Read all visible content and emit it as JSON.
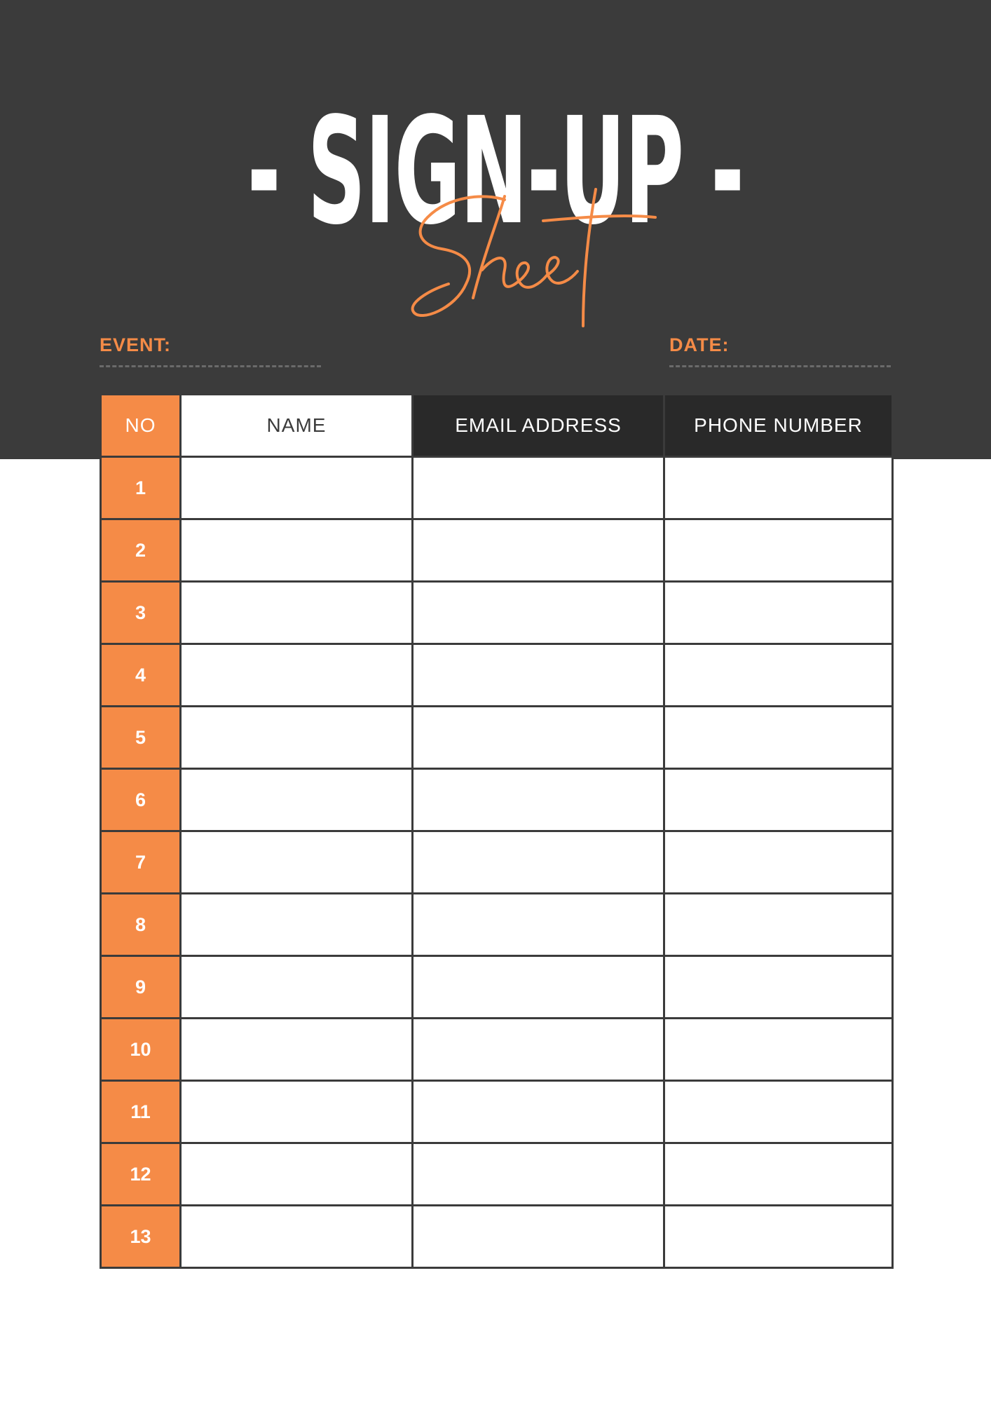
{
  "title": {
    "main": "- SIGN-UP -",
    "script": "Sheet"
  },
  "fields": {
    "event_label": "EVENT:",
    "date_label": "DATE:"
  },
  "table": {
    "headers": {
      "no": "NO",
      "name": "NAME",
      "email": "EMAIL ADDRESS",
      "phone": "PHONE NUMBER"
    },
    "rows": [
      {
        "no": "1",
        "name": "",
        "email": "",
        "phone": ""
      },
      {
        "no": "2",
        "name": "",
        "email": "",
        "phone": ""
      },
      {
        "no": "3",
        "name": "",
        "email": "",
        "phone": ""
      },
      {
        "no": "4",
        "name": "",
        "email": "",
        "phone": ""
      },
      {
        "no": "5",
        "name": "",
        "email": "",
        "phone": ""
      },
      {
        "no": "6",
        "name": "",
        "email": "",
        "phone": ""
      },
      {
        "no": "7",
        "name": "",
        "email": "",
        "phone": ""
      },
      {
        "no": "8",
        "name": "",
        "email": "",
        "phone": ""
      },
      {
        "no": "9",
        "name": "",
        "email": "",
        "phone": ""
      },
      {
        "no": "10",
        "name": "",
        "email": "",
        "phone": ""
      },
      {
        "no": "11",
        "name": "",
        "email": "",
        "phone": ""
      },
      {
        "no": "12",
        "name": "",
        "email": "",
        "phone": ""
      },
      {
        "no": "13",
        "name": "",
        "email": "",
        "phone": ""
      }
    ]
  },
  "colors": {
    "accent": "#f58b47",
    "header_band": "#3b3b3b",
    "dark_header_cell": "#292929",
    "grid_line": "#3b3b3b"
  }
}
